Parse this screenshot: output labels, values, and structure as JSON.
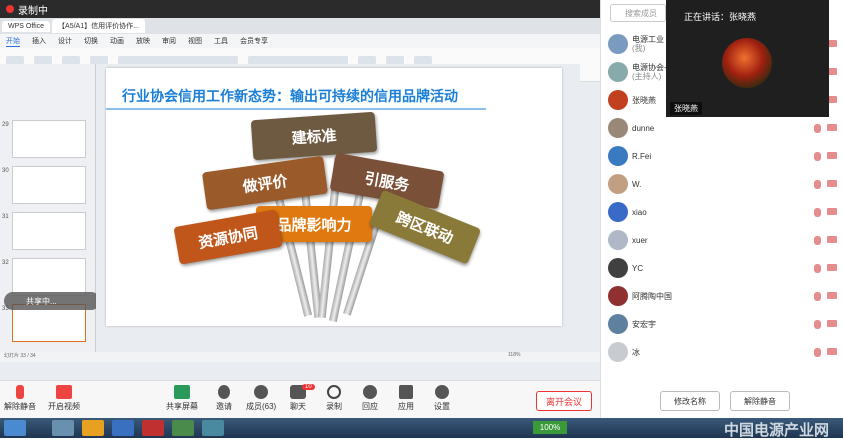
{
  "topbar": {
    "recording": "录制中"
  },
  "wps": {
    "tabs": [
      "WPS Office",
      "【A5/A1】信用评价协作..."
    ],
    "menu": [
      "开始",
      "插入",
      "设计",
      "切换",
      "动画",
      "放映",
      "审阅",
      "视图",
      "工具",
      "会员专享"
    ],
    "active_menu": "开始",
    "slide_numbers": [
      "29",
      "30",
      "31",
      "32",
      "33"
    ],
    "status": "幻灯片 33 / 34",
    "zoom_pct": "118%"
  },
  "slide": {
    "title": "行业协会信用工作新态势：输出可持续的信用品牌活动",
    "signs": [
      "建标准",
      "做评价",
      "引服务",
      "品牌影响力",
      "资源协同",
      "跨区联动"
    ]
  },
  "tip": "共享中...",
  "panel": {
    "search_placeholder": "搜索成员",
    "speaking": "正在讲话：张晓燕",
    "speaker_name": "张晓燕",
    "members": [
      {
        "name": "电源工业",
        "sub": "(我)",
        "color": "#7a9ac0"
      },
      {
        "name": "电源协会-",
        "sub": "(主持人)",
        "color": "#8aa"
      },
      {
        "name": "张晓燕",
        "sub": "",
        "color": "#c04020"
      },
      {
        "name": "dunne",
        "sub": "",
        "color": "#998877"
      },
      {
        "name": "R.Fei",
        "sub": "",
        "color": "#3a7ac0"
      },
      {
        "name": "W.",
        "sub": "",
        "color": "#c0a080"
      },
      {
        "name": "xiao",
        "sub": "",
        "color": "#3a6ac8"
      },
      {
        "name": "xuer",
        "sub": "",
        "color": "#b0b8c8"
      },
      {
        "name": "YC",
        "sub": "",
        "color": "#404040"
      },
      {
        "name": "阿腾陶中国",
        "sub": "",
        "color": "#903030"
      },
      {
        "name": "安宏宇",
        "sub": "",
        "color": "#6080a0"
      },
      {
        "name": "冰",
        "sub": "",
        "color": "#c8ccd0"
      }
    ],
    "btn_rename": "修改名称",
    "btn_unmute": "解除静音"
  },
  "toolbar": {
    "unmute": "解除静音",
    "video": "开启视频",
    "share": "共享屏幕",
    "invite": "邀请",
    "members": "成员(63)",
    "chat": "聊天",
    "chat_badge": "10",
    "record": "录制",
    "react": "回应",
    "apps": "应用",
    "settings": "设置",
    "end": "离开会议"
  },
  "taskbar": {
    "zoom": "100%"
  },
  "watermark": "中国电源产业网"
}
